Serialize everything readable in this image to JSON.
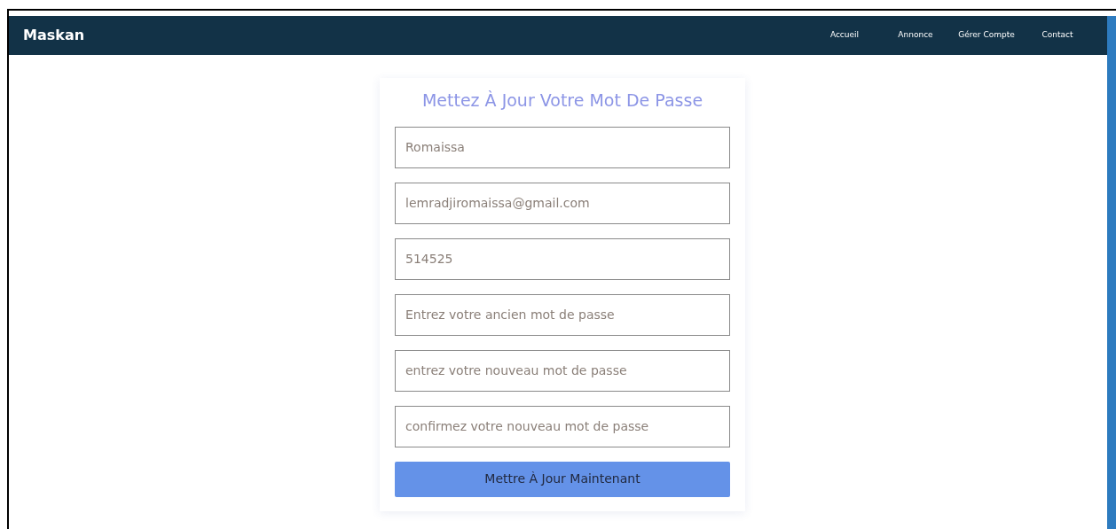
{
  "navbar": {
    "brand": "Maskan",
    "links": [
      {
        "label": "Accueil"
      },
      {
        "label": "Annonce"
      },
      {
        "label": "Gérer Compte"
      },
      {
        "label": "Contact"
      }
    ]
  },
  "form": {
    "title": "Mettez À Jour Votre Mot De Passe",
    "fields": [
      {
        "value": "Romaissa"
      },
      {
        "value": "lemradjiromaissa@gmail.com"
      },
      {
        "value": "514525"
      },
      {
        "placeholder": "Entrez votre ancien mot de passe"
      },
      {
        "placeholder": "entrez votre nouveau mot de passe"
      },
      {
        "placeholder": "confirmez votre nouveau mot de passe"
      }
    ],
    "submit": "Mettre À Jour Maintenant"
  }
}
